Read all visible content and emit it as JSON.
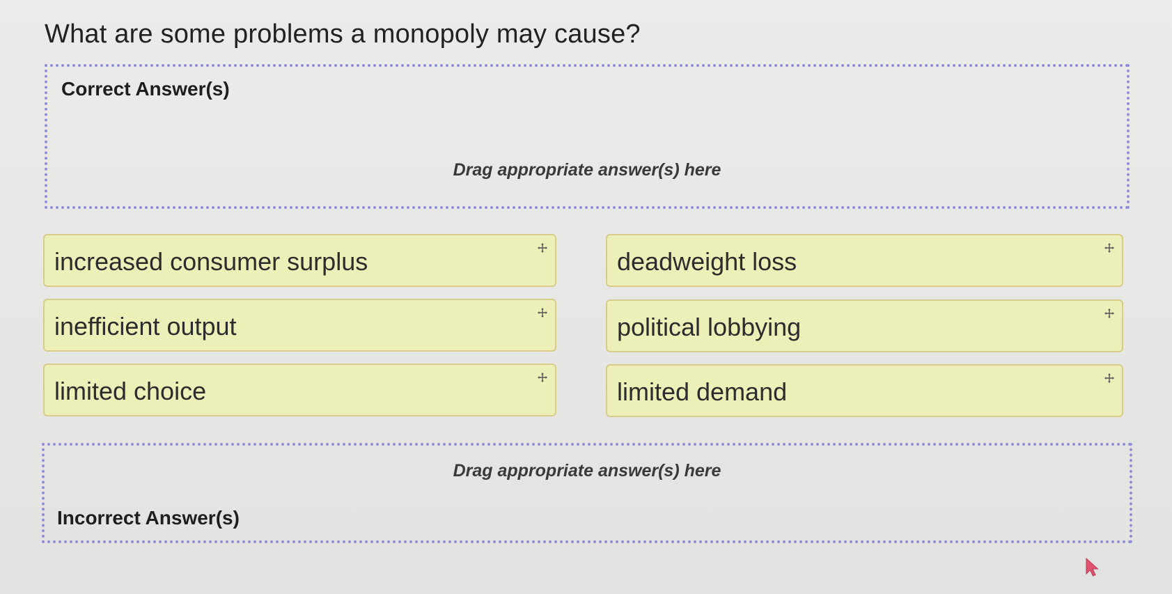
{
  "question": {
    "text": "What are some problems a monopoly may cause?"
  },
  "correct_zone": {
    "title": "Correct Answer(s)",
    "hint": "Drag appropriate answer(s) here"
  },
  "answer_options": [
    {
      "label": "increased consumer surplus",
      "icon": "move-icon"
    },
    {
      "label": "deadweight loss",
      "icon": "move-icon"
    },
    {
      "label": "inefficient output",
      "icon": "move-icon"
    },
    {
      "label": "political lobbying",
      "icon": "move-icon"
    },
    {
      "label": "limited choice",
      "icon": "move-icon"
    },
    {
      "label": "limited demand",
      "icon": "move-icon"
    }
  ],
  "incorrect_zone": {
    "title": "Incorrect Answer(s)",
    "hint": "Drag appropriate answer(s) here"
  },
  "colors": {
    "chip_background": "#ecefb8",
    "chip_border": "#d8cc8a",
    "dropzone_border": "#8f8fd8"
  }
}
